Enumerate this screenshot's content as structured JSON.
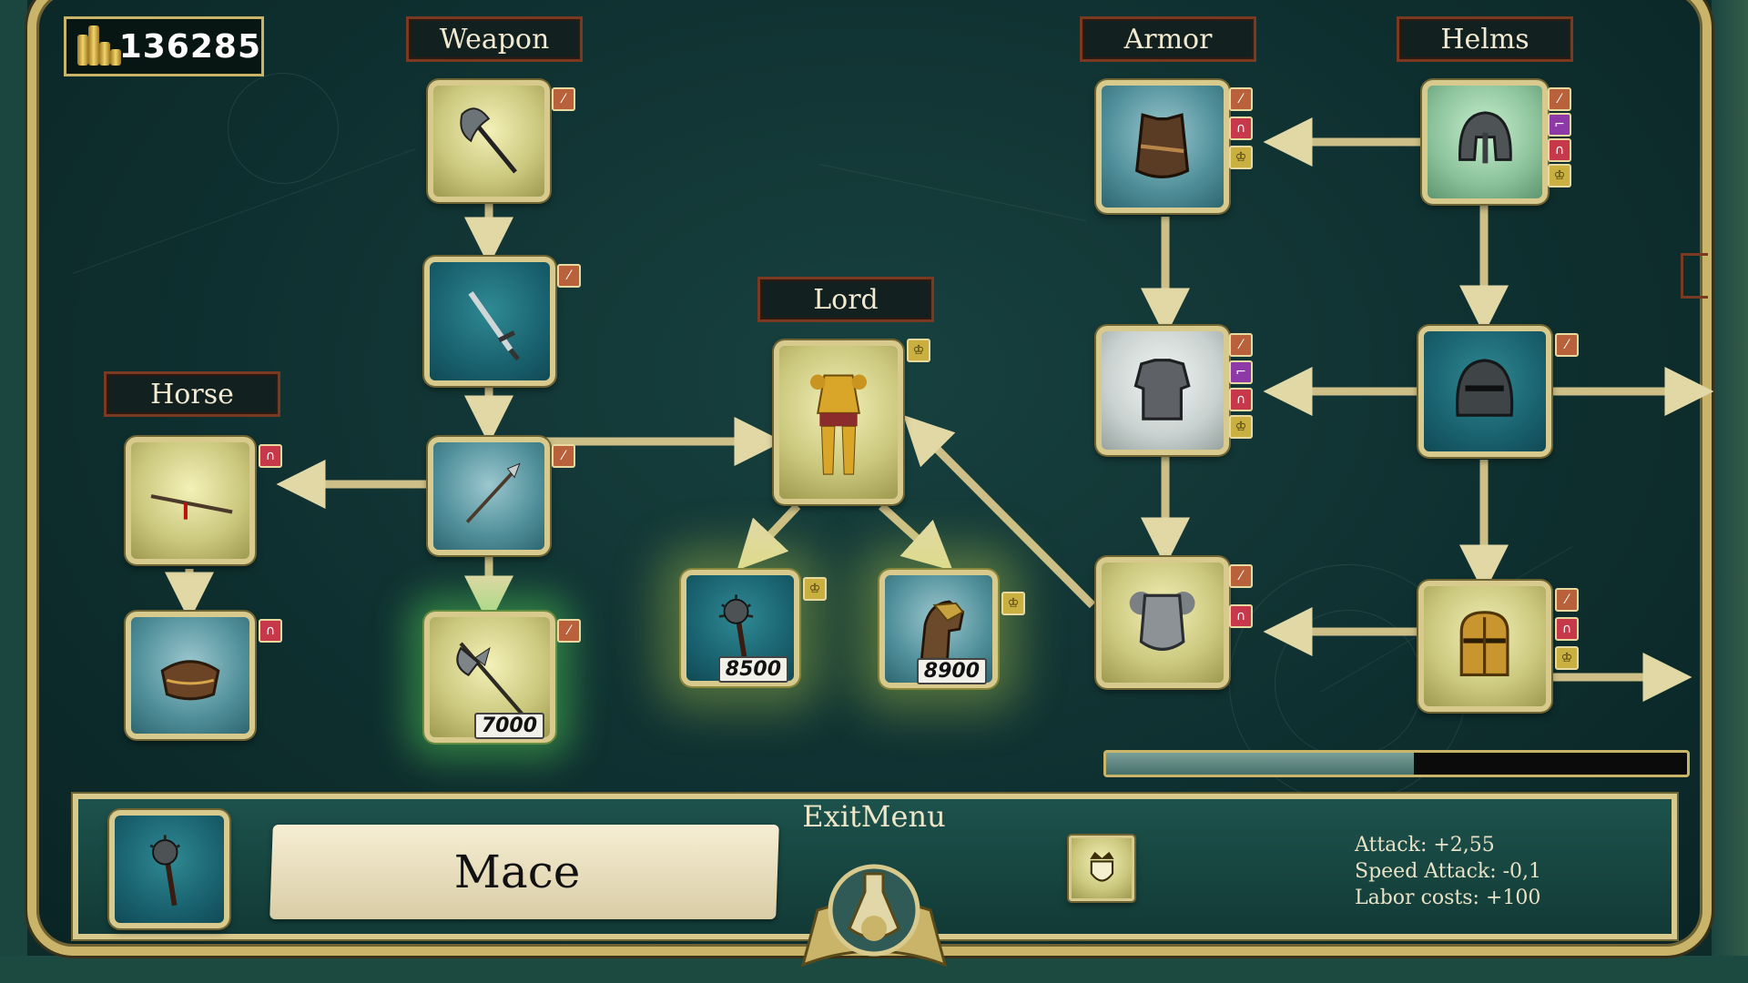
{
  "currency": {
    "icon": "gold-coins-icon",
    "amount": "136285"
  },
  "categories": {
    "weapon": "Weapon",
    "armor": "Armor",
    "helms": "Helms",
    "lord": "Lord",
    "horse": "Horse"
  },
  "items": {
    "axe": {
      "icon": "battle-axe-icon"
    },
    "sword": {
      "icon": "sword-icon"
    },
    "spear": {
      "icon": "spear-icon"
    },
    "halberd": {
      "icon": "halberd-icon",
      "price": "7000"
    },
    "lord_armor": {
      "icon": "golden-armor-icon"
    },
    "mace": {
      "icon": "mace-icon",
      "price": "8500"
    },
    "barding": {
      "icon": "horse-armor-icon",
      "price": "8900"
    },
    "lance": {
      "icon": "lance-icon"
    },
    "saddle": {
      "icon": "saddle-icon"
    },
    "leather_armor": {
      "icon": "leather-vest-icon"
    },
    "chainmail": {
      "icon": "chainmail-icon"
    },
    "plate_armor": {
      "icon": "plate-armor-icon"
    },
    "nasal_helm": {
      "icon": "nasal-helm-icon"
    },
    "closed_helm": {
      "icon": "closed-helm-icon"
    },
    "great_helm": {
      "icon": "great-helm-icon"
    }
  },
  "progress": {
    "fraction": 0.53,
    "fill_color": "#46706a"
  },
  "selected": {
    "name": "Mace",
    "icon": "mace-icon",
    "crown_icon": "crown-shield-icon",
    "stats": [
      "Attack: +2,55",
      "Speed Attack: -0,1",
      "Labor costs: +100"
    ]
  },
  "exit_menu": {
    "label": "ExitMenu",
    "icon": "book-flask-icon"
  },
  "colors": {
    "frame_gold": "#c9b46a",
    "label_border": "#7a3a22",
    "background": "#0f3030"
  }
}
